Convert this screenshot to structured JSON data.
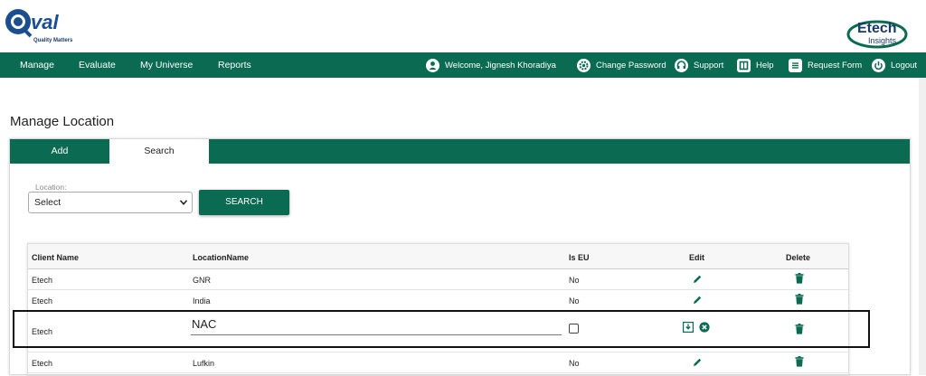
{
  "header": {
    "logo_left_text": "Q-val",
    "logo_left_tagline": "Quality Matters",
    "logo_right_text": "Etech",
    "logo_right_sub": "Insights",
    "brand_color": "#0a6b52"
  },
  "nav": {
    "items": [
      "Manage",
      "Evaluate",
      "My Universe",
      "Reports"
    ],
    "welcome": "Welcome, Jignesh Khoradiya",
    "change_password": "Change Password",
    "support": "Support",
    "help": "Help",
    "request_form": "Request Form",
    "logout": "Logout",
    "icons": [
      "user-icon",
      "gear-icon",
      "headset-icon",
      "help-book-icon",
      "form-icon",
      "power-icon"
    ]
  },
  "page": {
    "title": "Manage Location"
  },
  "tabs": {
    "add": "Add",
    "search": "Search",
    "active": "Search"
  },
  "filter": {
    "location_label": "Location:",
    "location_value": "Select",
    "search_button": "SEARCH"
  },
  "grid": {
    "columns": [
      "Client Name",
      "LocationName",
      "Is EU",
      "Edit",
      "Delete"
    ],
    "rows": [
      {
        "client": "Etech",
        "location": "GNR",
        "is_eu": "No"
      },
      {
        "client": "Etech",
        "location": "India",
        "is_eu": "No"
      },
      {
        "client": "Etech",
        "location": "NAC",
        "is_eu": "",
        "editing": true
      },
      {
        "client": "Etech",
        "location": "Lufkin",
        "is_eu": "No"
      }
    ]
  }
}
